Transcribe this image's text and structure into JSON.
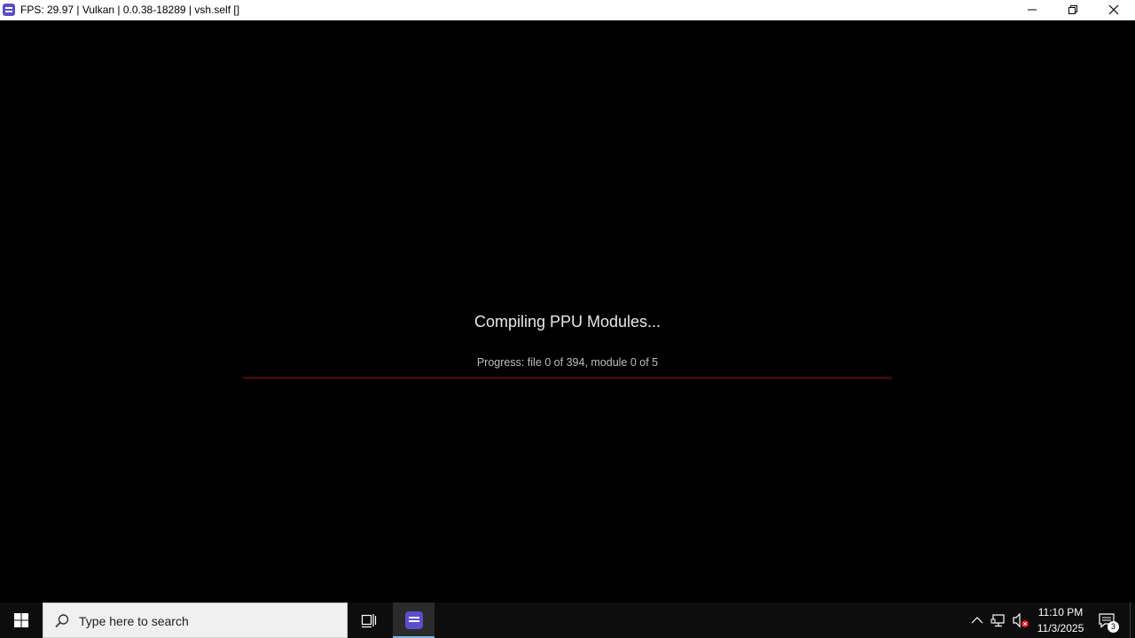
{
  "window": {
    "title": "FPS: 29.97 | Vulkan | 0.0.38-18289 | vsh.self []"
  },
  "main": {
    "heading": "Compiling PPU Modules...",
    "progress_text": "Progress: file 0 of 394, module 0 of 5",
    "progress_fraction": 0.0,
    "progress_track_color": "#3a0a0f",
    "progress_fill_color": "#c0182a"
  },
  "taskbar": {
    "search_placeholder": "Type here to search",
    "clock_time": "11:10 PM",
    "clock_date": "11/3/2025",
    "notification_count": "3",
    "accent_color": "#76b9ed"
  },
  "icons": {
    "app": "rpcs3-icon",
    "minimize": "minimize-icon",
    "maximize": "restore-icon",
    "close": "close-icon",
    "start": "windows-start-icon",
    "search": "search-icon",
    "taskview": "task-view-icon",
    "tray_chevron": "chevron-up-icon",
    "network": "network-icon",
    "volume": "volume-muted-icon",
    "notifications": "notification-center-icon"
  }
}
